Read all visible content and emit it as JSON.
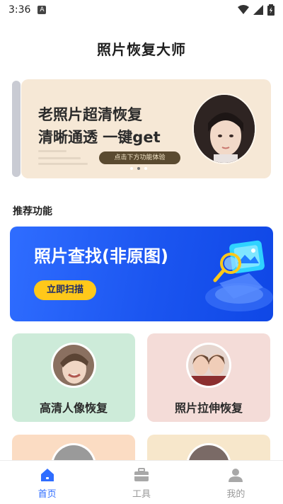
{
  "status_bar": {
    "time": "3:36",
    "notification_badge": "A"
  },
  "page": {
    "title": "照片恢复大师"
  },
  "banner": {
    "line1": "老照片超清恢复",
    "line2": "清晰通透 一键get",
    "pill": "点击下方功能体验",
    "active_dot_index": 1,
    "dot_count": 3
  },
  "section": {
    "recommended_title": "推荐功能"
  },
  "scan_card": {
    "title": "照片查找(非原图)",
    "button_label": "立即扫描"
  },
  "features": [
    {
      "label": "高清人像恢复"
    },
    {
      "label": "照片拉伸恢复"
    }
  ],
  "bottom_nav": {
    "items": [
      {
        "label": "首页",
        "icon": "home-icon",
        "active": true
      },
      {
        "label": "工具",
        "icon": "toolbox-icon",
        "active": false
      },
      {
        "label": "我的",
        "icon": "profile-icon",
        "active": false
      }
    ]
  },
  "colors": {
    "accent": "#2f6dff",
    "scan_button": "#ffc81a",
    "banner_bg": "#f6e8d6",
    "card_green": "#cdebd9",
    "card_pink": "#f4dcd8"
  }
}
